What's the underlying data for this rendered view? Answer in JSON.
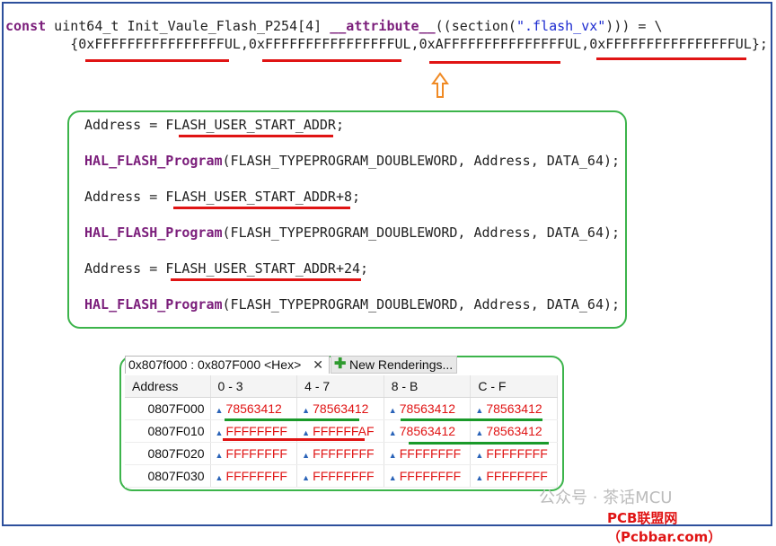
{
  "code_top": {
    "line1_const": "const",
    "line1_decl": " uint64_t Init_Vaule_Flash_P254[4] ",
    "line1_attr": "__attribute__",
    "line1_mid": "((section(",
    "line1_str": "\".flash_vx\"",
    "line1_end": "))) = \\",
    "line2": "        {0xFFFFFFFFFFFFFFFFUL,0xFFFFFFFFFFFFFFFFUL,0xAFFFFFFFFFFFFFFFUL,0xFFFFFFFFFFFFFFFFUL};"
  },
  "code_block": [
    {
      "pre": "Address = ",
      "val": "FLASH_USER_START_ADDR;"
    },
    {
      "fn": "HAL_FLASH_Program",
      "args": "(FLASH_TYPEPROGRAM_DOUBLEWORD, Address, DATA_64);"
    },
    {
      "pre": "Address = ",
      "val": "FLASH_USER_START_ADDR+8;"
    },
    {
      "fn": "HAL_FLASH_Program",
      "args": "(FLASH_TYPEPROGRAM_DOUBLEWORD, Address, DATA_64);"
    },
    {
      "pre": "Address = ",
      "val": "FLASH_USER_START_ADDR+24;"
    },
    {
      "fn": "HAL_FLASH_Program",
      "args": "(FLASH_TYPEPROGRAM_DOUBLEWORD, Address, DATA_64);"
    }
  ],
  "memory_view": {
    "tab_label": "0x807f000 : 0x807F000 <Hex>",
    "tab_close": "✕",
    "new_tab_label": "New Renderings...",
    "headers": [
      "Address",
      "0 - 3",
      "4 - 7",
      "8 - B",
      "C - F"
    ],
    "rows": [
      {
        "addr": "0807F000",
        "vals": [
          "78563412",
          "78563412",
          "78563412",
          "78563412"
        ]
      },
      {
        "addr": "0807F010",
        "vals": [
          "FFFFFFFF",
          "FFFFFFAF",
          "78563412",
          "78563412"
        ]
      },
      {
        "addr": "0807F020",
        "vals": [
          "FFFFFFFF",
          "FFFFFFFF",
          "FFFFFFFF",
          "FFFFFFFF"
        ]
      },
      {
        "addr": "0807F030",
        "vals": [
          "FFFFFFFF",
          "FFFFFFFF",
          "FFFFFFFF",
          "FFFFFFFF"
        ]
      }
    ]
  },
  "watermark": "公众号 · 茶话MCU",
  "watermark2": "PCB联盟网（Pcbbar.com）",
  "colors": {
    "highlight_red": "#e01414",
    "highlight_green": "#1a9a2a",
    "arrow_orange": "#f08a24"
  }
}
